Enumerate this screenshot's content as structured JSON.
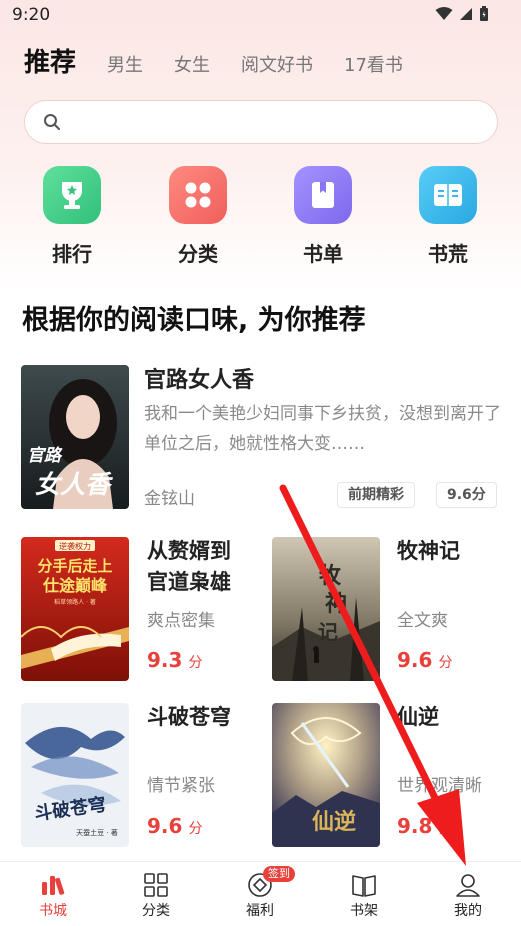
{
  "status_bar": {
    "time": "9:20"
  },
  "tabs": [
    "推荐",
    "男生",
    "女生",
    "阅文好书",
    "17看书"
  ],
  "search": {
    "placeholder": ""
  },
  "quick_entries": [
    {
      "label": "排行",
      "icon": "trophy-icon",
      "color": "#43c986"
    },
    {
      "label": "分类",
      "icon": "grid-icon",
      "color": "#f26d6b"
    },
    {
      "label": "书单",
      "icon": "book-icon",
      "color": "#8c78f0"
    },
    {
      "label": "书荒",
      "icon": "open-book-icon",
      "color": "#33b6ec"
    }
  ],
  "section": {
    "title": "根据你的阅读口味, 为你推荐"
  },
  "featured": {
    "title": "官路女人香",
    "description": "我和一个美艳少妇同事下乡扶贫，没想到离开了单位之后，她就性格大变……",
    "author": "金铉山",
    "tags": [
      "前期精彩",
      "9.6分"
    ],
    "cover_text": [
      "官路",
      "女人香"
    ]
  },
  "grid_books": [
    {
      "title_lines": [
        "从赘婿到",
        "官道枭雄"
      ],
      "tag": "爽点密集",
      "score": "9.3",
      "unit": "分",
      "cover_text": [
        "分手后走上",
        "仕途巅峰"
      ],
      "cover_badge": "逆袭权力",
      "cover_sub": "稻草领路人 · 著"
    },
    {
      "title_lines": [
        "牧神记"
      ],
      "tag": "全文爽",
      "score": "9.6",
      "unit": "分",
      "cover_text": [
        "牧",
        "神",
        "记"
      ]
    },
    {
      "title_lines": [
        "斗破苍穹"
      ],
      "tag": "情节紧张",
      "score": "9.6",
      "unit": "分",
      "cover_text": [
        "斗破苍穹"
      ],
      "cover_sub": "天蚕土豆 · 著"
    },
    {
      "title_lines": [
        "仙逆"
      ],
      "tag": "世界观清晰",
      "score": "9.8",
      "unit": "分",
      "cover_text": [
        "仙逆"
      ]
    }
  ],
  "bottom_nav": [
    {
      "label": "书城",
      "icon": "bookstore-icon",
      "active": true
    },
    {
      "label": "分类",
      "icon": "category-icon",
      "active": false
    },
    {
      "label": "福利",
      "icon": "welfare-icon",
      "active": false,
      "badge": "签到"
    },
    {
      "label": "书架",
      "icon": "bookshelf-icon",
      "active": false
    },
    {
      "label": "我的",
      "icon": "profile-icon",
      "active": false
    }
  ],
  "colors": {
    "accent": "#e8413c",
    "annotation": "#ee1c1c"
  }
}
